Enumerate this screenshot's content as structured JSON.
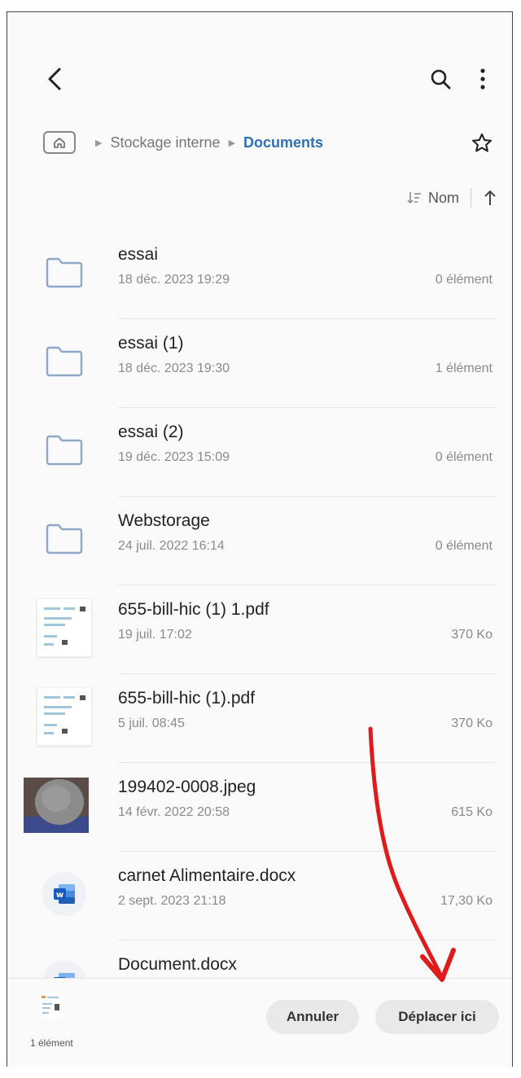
{
  "breadcrumb": {
    "root": "Stockage interne",
    "current": "Documents"
  },
  "sort": {
    "label": "Nom"
  },
  "files": [
    {
      "name": "essai",
      "date": "18 déc. 2023 19:29",
      "size": "0 élément",
      "type": "folder"
    },
    {
      "name": "essai (1)",
      "date": "18 déc. 2023 19:30",
      "size": "1 élément",
      "type": "folder"
    },
    {
      "name": "essai (2)",
      "date": "19 déc. 2023 15:09",
      "size": "0 élément",
      "type": "folder"
    },
    {
      "name": "Webstorage",
      "date": "24 juil. 2022 16:14",
      "size": "0 élément",
      "type": "folder"
    },
    {
      "name": "655-bill-hic (1) 1.pdf",
      "date": "19 juil. 17:02",
      "size": "370 Ko",
      "type": "pdf"
    },
    {
      "name": "655-bill-hic (1).pdf",
      "date": "5 juil. 08:45",
      "size": "370 Ko",
      "type": "pdf"
    },
    {
      "name": "199402-0008.jpeg",
      "date": "14 févr. 2022 20:58",
      "size": "615 Ko",
      "type": "image"
    },
    {
      "name": "carnet Alimentaire.docx",
      "date": "2 sept. 2023 21:18",
      "size": "17,30 Ko",
      "type": "word"
    },
    {
      "name": "Document.docx",
      "date": "",
      "size": "",
      "type": "word"
    }
  ],
  "bottom": {
    "selection_count": "1 élément",
    "cancel_label": "Annuler",
    "move_label": "Déplacer ici"
  },
  "colors": {
    "accent": "#2f6fb5",
    "folder_stroke": "#8fa7c9",
    "annotation": "#e01b1b"
  },
  "icons": [
    "back-arrow-icon",
    "search-icon",
    "more-vert-icon",
    "home-icon",
    "star-outline-icon",
    "sort-icon",
    "arrow-up-icon",
    "folder-icon",
    "pdf-thumbnail-icon",
    "photo-thumbnail-icon",
    "word-icon"
  ]
}
